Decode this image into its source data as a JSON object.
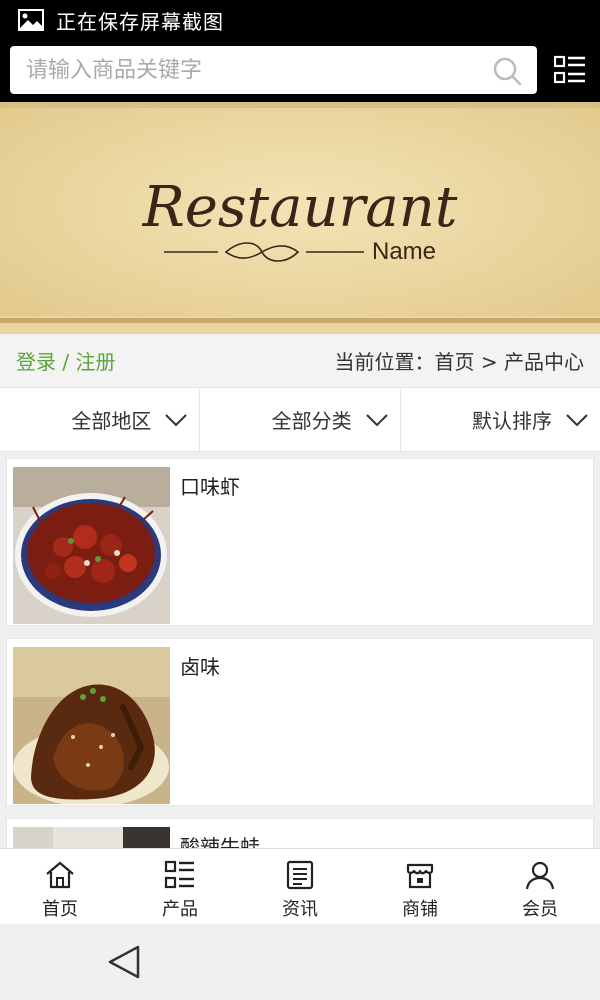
{
  "status_bar": {
    "text": "正在保存屏幕截图",
    "icon": "image-icon"
  },
  "header": {
    "search_placeholder": "请输入商品关键字",
    "search_icon": "search-icon",
    "menu_icon": "list-menu-icon"
  },
  "banner": {
    "title": "Restaurant",
    "subtitle": "Name",
    "background_color": "#ecd9a4",
    "text_color": "#3b2518"
  },
  "breadcrumb": {
    "login_text": "登录 / 注册",
    "location_text": "当前位置：首页 > 产品中心",
    "login_color": "#5aa53c"
  },
  "filters": [
    {
      "label": "全部地区"
    },
    {
      "label": "全部分类"
    },
    {
      "label": "默认排序"
    }
  ],
  "products": [
    {
      "name": "口味虾"
    },
    {
      "name": "卤味"
    },
    {
      "name": "酸辣牛蛙"
    }
  ],
  "bottom_nav": [
    {
      "label": "首页",
      "icon": "home-icon"
    },
    {
      "label": "产品",
      "icon": "list-icon"
    },
    {
      "label": "资讯",
      "icon": "news-icon"
    },
    {
      "label": "商铺",
      "icon": "store-icon"
    },
    {
      "label": "会员",
      "icon": "user-icon"
    }
  ],
  "system_nav": {
    "back_icon": "back-triangle-icon"
  }
}
